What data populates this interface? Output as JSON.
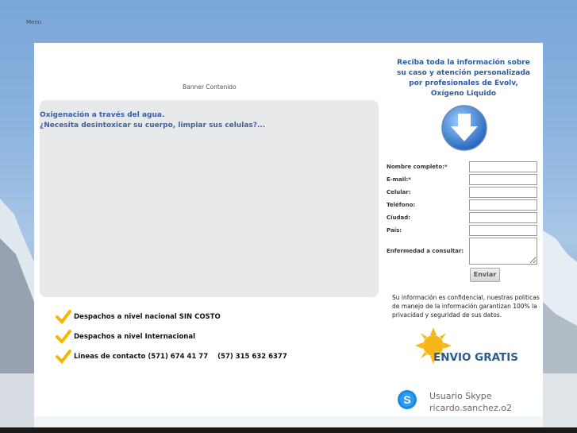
{
  "nav": {
    "menu_label": "Menu"
  },
  "banner": {
    "label": "Banner Contenido"
  },
  "content": {
    "lines": [
      "Oxigenación a través del agua.",
      "¿Necesita desintoxicar su cuerpo, limpiar sus celulas?..."
    ]
  },
  "features": [
    {
      "text": "Despachos a nivel nacional SIN COSTO"
    },
    {
      "text": "Despachos a nivel Internacional"
    },
    {
      "text": "Lineas de contacto (571) 674 41 77",
      "extra": "(57) 315 632 6377"
    }
  ],
  "sidebar": {
    "promo": "Reciba toda la información sobre su caso y atención personalizada por profesionales de Evolv, Oxígeno Liquido",
    "form": {
      "fields": [
        {
          "label": "Nombre completo:*",
          "value": ""
        },
        {
          "label": "E-mail:*",
          "value": ""
        },
        {
          "label": "Celular:",
          "value": ""
        },
        {
          "label": "Teléfono:",
          "value": ""
        },
        {
          "label": "Ciudad:",
          "value": ""
        },
        {
          "label": "País:",
          "value": ""
        }
      ],
      "textarea_label": "Enfermedad a consultar:",
      "submit_label": "Enviar"
    },
    "privacy": "Su información es confidencial, nuestras politicas de manejo de la información garantizan 100% la privacidad y seguridad de sus datos.",
    "envio_label": "ENVIO GRATIS",
    "skype": {
      "line1": "Usuario Skype",
      "line2": "ricardo.sanchez.o2"
    }
  },
  "colors": {
    "accent": "#2c5aa0",
    "content_text": "#3d5fa5",
    "check": "#f2b705"
  },
  "icons": [
    "down-arrow-icon",
    "check-icon",
    "sun-icon",
    "skype-icon"
  ]
}
